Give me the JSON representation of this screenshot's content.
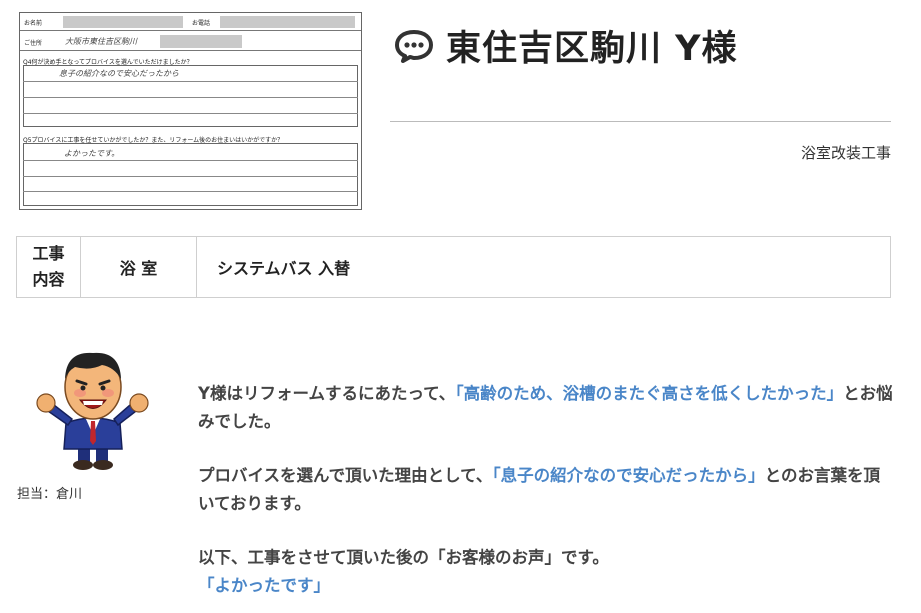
{
  "survey": {
    "name_label": "お名前",
    "tel_label": "お電話",
    "address_label": "ご住所",
    "address_hand": "大阪市東住吉区駒川",
    "q4_label": "Q4何が決め手となってプロバイスを選んでいただけましたか？",
    "q4_answer": "息子の紹介なので安心だったから",
    "q5_label": "Q5プロバイスに工事を任せていかがでしたか？また、リフォーム後のお住まいはいかがですか？",
    "q5_answer": "よかったです。"
  },
  "header": {
    "title": "東住吉区駒川 Y様",
    "category": "浴室改装工事"
  },
  "work": {
    "label_line1": "工事",
    "label_line2": "内容",
    "area": "浴 室",
    "detail": "システムバス 入替"
  },
  "staff": {
    "label": "担当：倉川"
  },
  "body": {
    "p1_pre": "Y様はリフォームするにあたって、",
    "p1_hl": "「高齢のため、浴槽のまたぐ高さを低くしたかった」",
    "p1_post": "とお悩みでした。",
    "p2_pre": "プロバイスを選んで頂いた理由として、",
    "p2_hl": "「息子の紹介なので安心だったから」",
    "p2_post": "とのお言葉を頂いております。",
    "p3_pre": "以下、工事をさせて頂いた後の「お客様のお声」です。",
    "p3_hl": "「よかったです」"
  },
  "colors": {
    "highlight": "#4a86c8",
    "text": "#444444"
  },
  "icons": {
    "title_icon": "speech-bubble-icon"
  }
}
